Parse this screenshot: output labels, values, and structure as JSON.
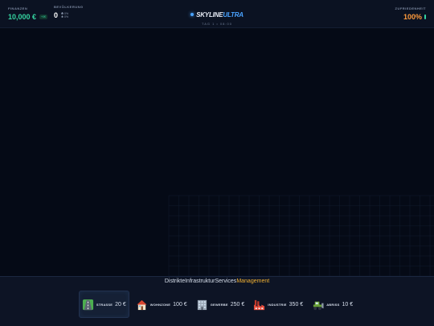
{
  "hud": {
    "finance": {
      "label": "FINANZEN",
      "value": "10,000 €",
      "delta": "+0€"
    },
    "population": {
      "label": "BEVÖLKERUNG",
      "value": "0",
      "employment": "0%",
      "housing": "0%"
    },
    "brand": {
      "title_main": "SKYLINE",
      "title_accent": "ULTRA",
      "subtitle": "TAG 1 • 08:00"
    },
    "satisfaction": {
      "label": "ZUFRIEDENHEIT",
      "value": "100%",
      "level": 1.0
    }
  },
  "tabs": [
    {
      "label": "Distrikte",
      "active": false
    },
    {
      "label": "Infrastruktur",
      "active": false
    },
    {
      "label": "Services",
      "active": false
    },
    {
      "label": "Management",
      "active": true
    }
  ],
  "tools": [
    {
      "name": "STRASSE",
      "price": "20 €",
      "icon": "road-icon",
      "selected": true
    },
    {
      "name": "WOHNZONE",
      "price": "100 €",
      "icon": "house-icon",
      "selected": false
    },
    {
      "name": "GEWERBE",
      "price": "250 €",
      "icon": "office-building-icon",
      "selected": false
    },
    {
      "name": "INDUSTRIE",
      "price": "350 €",
      "icon": "factory-icon",
      "selected": false
    },
    {
      "name": "ABRISS",
      "price": "10 €",
      "icon": "bulldozer-icon",
      "selected": false
    }
  ],
  "colors": {
    "background": "#050a16",
    "panel": "#0b1222",
    "money": "#34d3a0",
    "accent": "#4aa3ff",
    "satisfaction": "#ff9a3c",
    "active_tab": "#f2b233"
  }
}
